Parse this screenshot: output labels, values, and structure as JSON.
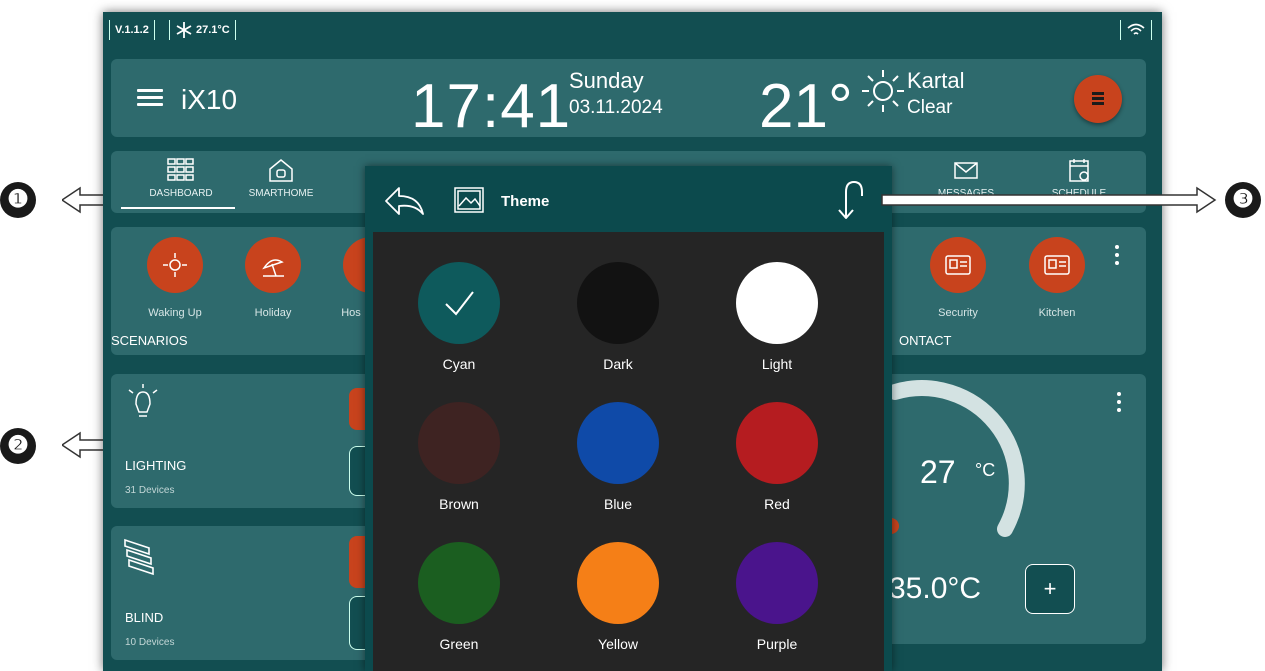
{
  "status_bar": {
    "version": "V.1.1.2",
    "temperature": "27.1°C",
    "wifi_icon": "wifi-icon",
    "snowflake_icon": "snowflake-icon"
  },
  "header": {
    "app_name": "iX10",
    "time": "17:41",
    "day": "Sunday",
    "date": "03.11.2024",
    "weather_temp": "21°",
    "location": "Kartal",
    "condition": "Clear"
  },
  "nav": {
    "dashboard": "DASHBOARD",
    "smarthome": "SMARTHOME",
    "messages": "MESSAGES",
    "schedule": "SCHEDULE"
  },
  "scenarios": {
    "title": "SCENARIOS",
    "contact_title": "ONTACT",
    "items": [
      {
        "label": "Waking Up"
      },
      {
        "label": "Holiday"
      },
      {
        "label": "Hos"
      },
      {
        "label": "Security"
      },
      {
        "label": "Kitchen"
      }
    ]
  },
  "lighting": {
    "title": "LIGHTING",
    "devices": "31 Devices"
  },
  "blind": {
    "title": "BLIND",
    "devices": "10 Devices"
  },
  "thermostat": {
    "current": "27",
    "unit": "°C",
    "setpoint": "35.0°C",
    "plus": "+"
  },
  "theme_dialog": {
    "title": "Theme",
    "selected": "Cyan",
    "options": [
      {
        "label": "Cyan",
        "color": "#0e5a5c"
      },
      {
        "label": "Dark",
        "color": "#121212"
      },
      {
        "label": "Light",
        "color": "#ffffff"
      },
      {
        "label": "Brown",
        "color": "#3e2322"
      },
      {
        "label": "Blue",
        "color": "#0f4aa8"
      },
      {
        "label": "Red",
        "color": "#b51c20"
      },
      {
        "label": "Green",
        "color": "#1b5e20"
      },
      {
        "label": "Yellow",
        "color": "#f57f17"
      },
      {
        "label": "Purple",
        "color": "#4a148c"
      }
    ]
  },
  "callouts": [
    "❶",
    "❷",
    "❸"
  ],
  "colors": {
    "accent": "#c8431d",
    "panel": "#2e6a6d",
    "background": "#124e51"
  }
}
